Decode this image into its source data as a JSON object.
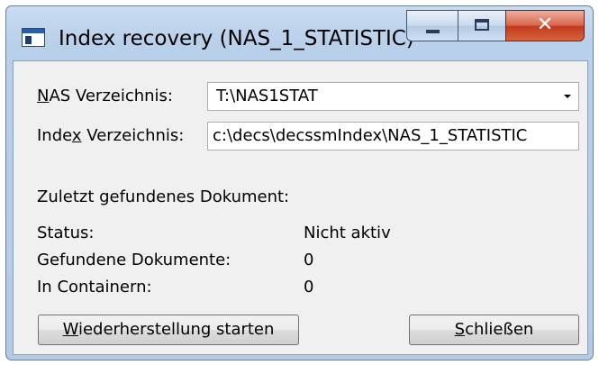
{
  "window": {
    "title": "Index recovery (NAS_1_STATISTIC)",
    "controls": {
      "minimize": "minimize",
      "maximize": "maximize",
      "close": "✕"
    }
  },
  "form": {
    "nas_label_mnemonic": "N",
    "nas_label_rest": "AS Verzeichnis:",
    "nas_value": "T:\\NAS1STAT",
    "index_label_pre": "Inde",
    "index_label_mnemonic": "x",
    "index_label_post": " Verzeichnis:",
    "index_value": "c:\\decs\\decssmIndex\\NAS_1_STATISTIC"
  },
  "status_section": {
    "last_found_label": "Zuletzt gefundenes Dokument:",
    "status_label": "Status:",
    "status_value": "Nicht aktiv",
    "found_label": "Gefundene Dokumente:",
    "found_value": "0",
    "containers_label": "In Containern:",
    "containers_value": "0"
  },
  "buttons": {
    "start_mnemonic": "W",
    "start_rest": "iederherstellung starten",
    "close_mnemonic": "S",
    "close_rest": "chließen"
  }
}
